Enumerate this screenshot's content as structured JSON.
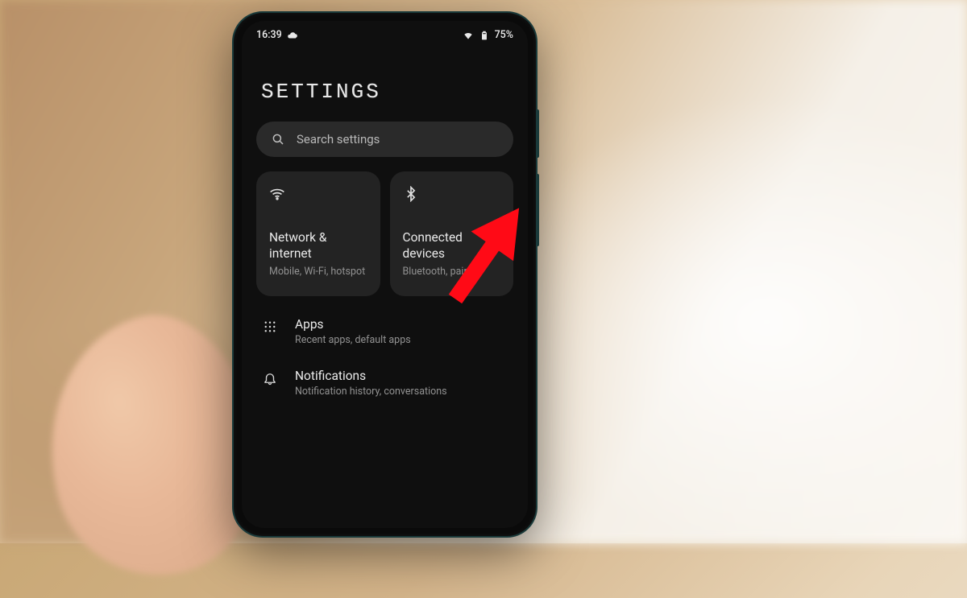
{
  "statusbar": {
    "time": "16:39",
    "battery_pct": "75%"
  },
  "header": {
    "title": "SETTINGS"
  },
  "search": {
    "placeholder": "Search settings"
  },
  "cards": [
    {
      "icon": "wifi-icon",
      "title": "Network & internet",
      "subtitle": "Mobile, Wi-Fi, hotspot"
    },
    {
      "icon": "bluetooth-icon",
      "title": "Connected devices",
      "subtitle": "Bluetooth, pairing"
    }
  ],
  "list": [
    {
      "icon": "apps-icon",
      "title": "Apps",
      "subtitle": "Recent apps, default apps"
    },
    {
      "icon": "bell-icon",
      "title": "Notifications",
      "subtitle": "Notification history, conversations"
    }
  ],
  "annotation": {
    "color": "#ff0a16"
  }
}
